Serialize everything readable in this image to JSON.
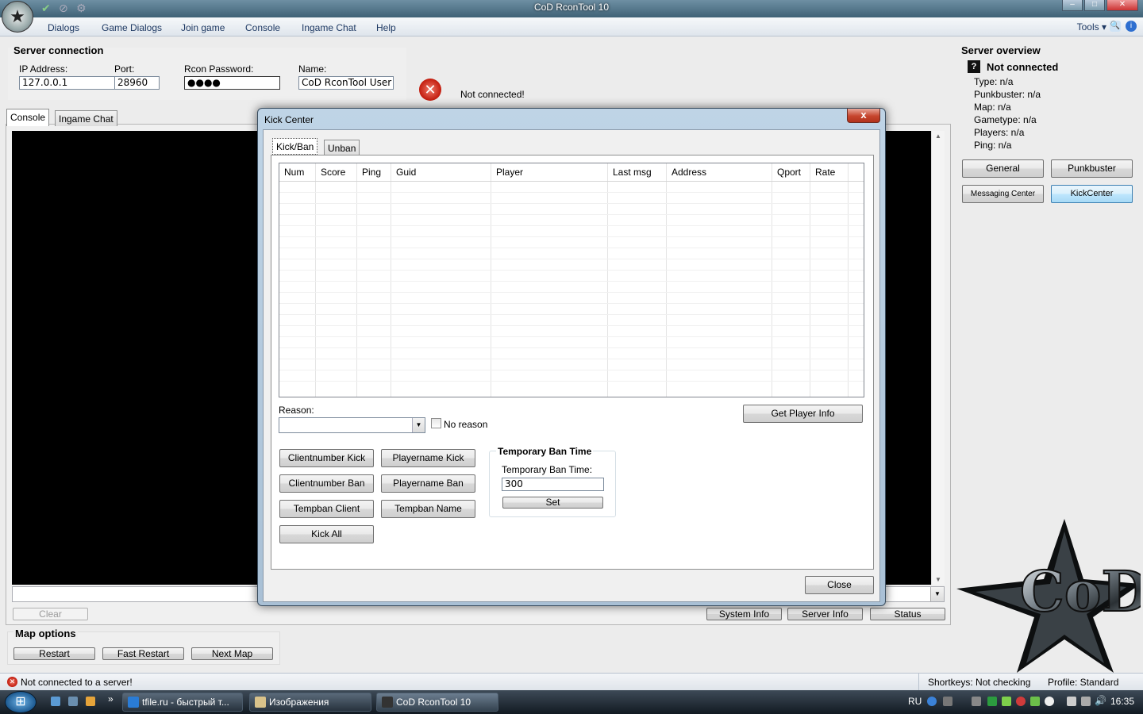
{
  "window": {
    "title": "CoD RconTool 10"
  },
  "menu": {
    "items": [
      "Dialogs",
      "Game Dialogs",
      "Join game",
      "Console",
      "Ingame Chat",
      "Help"
    ],
    "tools": "Tools"
  },
  "server_connection": {
    "title": "Server connection",
    "ip_label": "IP Address:",
    "ip_value": "127.0.0.1",
    "port_label": "Port:",
    "port_value": "28960",
    "rcon_label": "Rcon Password:",
    "rcon_value": "●●●●",
    "name_label": "Name:",
    "name_value": "CoD RconTool User",
    "status_text": "Not connected!"
  },
  "main_tabs": [
    "Console",
    "Ingame Chat"
  ],
  "console": {
    "clear_label": "Clear",
    "system_info": "System Info",
    "server_info": "Server Info",
    "status": "Status"
  },
  "map_options": {
    "title": "Map options",
    "restart": "Restart",
    "fast_restart": "Fast Restart",
    "next_map": "Next Map"
  },
  "server_overview": {
    "title": "Server overview",
    "status": "Not connected",
    "type": "Type: n/a",
    "punkbuster": "Punkbuster: n/a",
    "map": "Map: n/a",
    "gametype": "Gametype: n/a",
    "players": "Players: n/a",
    "ping": "Ping: n/a",
    "btn_general": "General",
    "btn_punkbuster": "Punkbuster",
    "btn_messaging": "Messaging Center",
    "btn_kickcenter": "KickCenter"
  },
  "kick_center": {
    "title": "Kick Center",
    "close_x": "x",
    "tabs": [
      "Kick/Ban",
      "Unban"
    ],
    "columns": [
      "Num",
      "Score",
      "Ping",
      "Guid",
      "Player",
      "Last msg",
      "Address",
      "Qport",
      "Rate"
    ],
    "reason_label": "Reason:",
    "reason_value": "",
    "no_reason": "No reason",
    "get_player_info": "Get Player Info",
    "buttons": {
      "clientnumber_kick": "Clientnumber Kick",
      "playername_kick": "Playername Kick",
      "clientnumber_ban": "Clientnumber Ban",
      "playername_ban": "Playername Ban",
      "tempban_client": "Tempban Client",
      "tempban_name": "Tempban Name",
      "kick_all": "Kick All"
    },
    "tempban_group_title": "Temporary Ban Time",
    "tempban_label": "Temporary Ban Time:",
    "tempban_value": "300",
    "set": "Set",
    "close": "Close"
  },
  "status_bar": {
    "message": "Not connected to a server!",
    "shortkeys": "Shortkeys: Not checking",
    "profile": "Profile: Standard"
  },
  "taskbar": {
    "tasks": [
      "tfile.ru - быстрый т...",
      "Изображения",
      "CoD RconTool 10"
    ],
    "lang": "RU",
    "clock": "16:35"
  }
}
